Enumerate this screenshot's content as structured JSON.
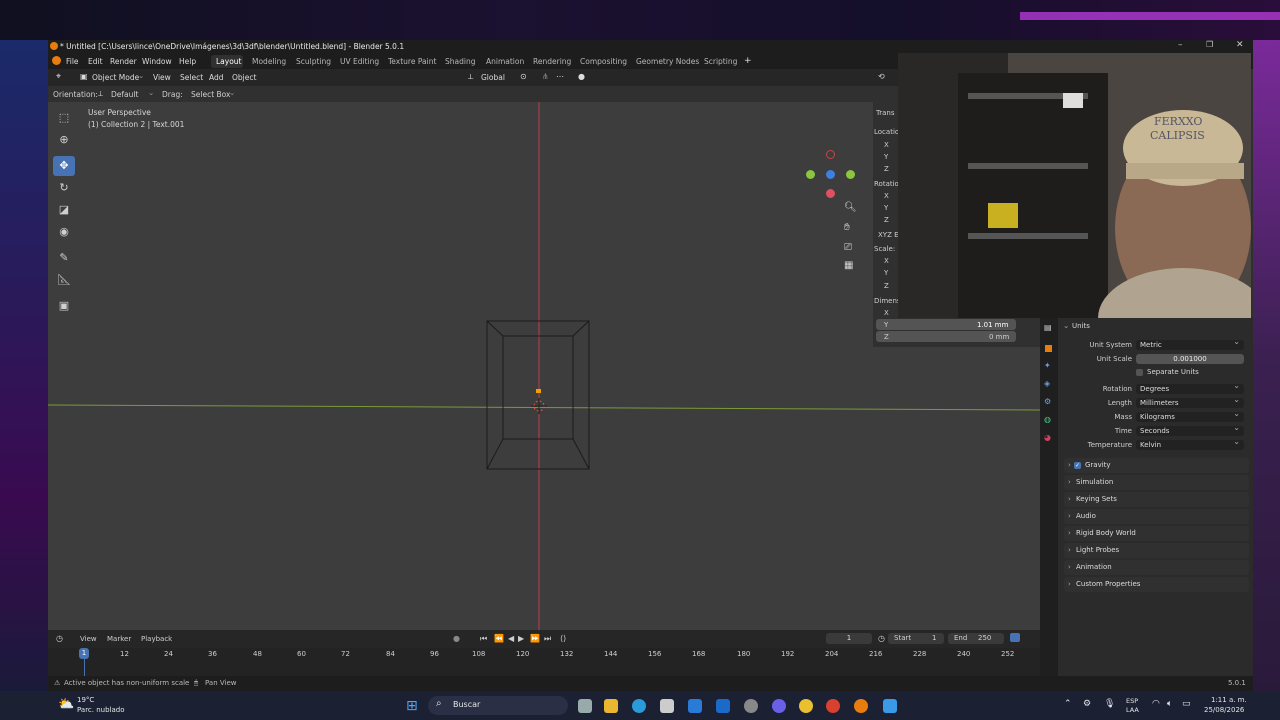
{
  "window": {
    "title": "* Untitled [C:\\Users\\lince\\OneDrive\\Imágenes\\3d\\3df\\blender\\Untitled.blend] - Blender 5.0.1"
  },
  "menu": {
    "file": "File",
    "edit": "Edit",
    "render": "Render",
    "window": "Window",
    "help": "Help"
  },
  "workspaces": [
    "Layout",
    "Modeling",
    "Sculpting",
    "UV Editing",
    "Texture Paint",
    "Shading",
    "Animation",
    "Rendering",
    "Compositing",
    "Geometry Nodes",
    "Scripting"
  ],
  "active_workspace": "Layout",
  "add_workspace_glyph": "+",
  "viewport_header": {
    "mode": "Object Mode",
    "view": "View",
    "select": "Select",
    "add": "Add",
    "object": "Object",
    "transform_orientation": "Global"
  },
  "tool_settings": {
    "orientation_label": "Orientation:",
    "orientation_value": "Default",
    "drag_label": "Drag:",
    "drag_value": "Select Box"
  },
  "viewport": {
    "perspective": "User Perspective",
    "collection_info": "(1) Collection 2 | Text.001"
  },
  "npanel": {
    "tab": "Trans",
    "location": "Location:",
    "rotation": "Rotation:",
    "rotation_mode": "XYZ E",
    "scale": "Scale:",
    "dimensions": "Dimens",
    "axes": [
      "X",
      "Y",
      "Z"
    ],
    "dim_y": "1.01 mm",
    "dim_z": "0 mm"
  },
  "properties": {
    "panel_title": "Units",
    "unit_system_label": "Unit System",
    "unit_system": "Metric",
    "unit_scale_label": "Unit Scale",
    "unit_scale": "0.001000",
    "separate_units": "Separate Units",
    "rotation_label": "Rotation",
    "rotation": "Degrees",
    "length_label": "Length",
    "length": "Millimeters",
    "mass_label": "Mass",
    "mass": "Kilograms",
    "time_label": "Time",
    "time": "Seconds",
    "temperature_label": "Temperature",
    "temperature": "Kelvin",
    "sections": [
      "Gravity",
      "Simulation",
      "Keying Sets",
      "Audio",
      "Rigid Body World",
      "Light Probes",
      "Animation",
      "Custom Properties"
    ]
  },
  "timeline": {
    "view": "View",
    "marker": "Marker",
    "playback": "Playback",
    "current_frame": "1",
    "start_label": "Start",
    "start": "1",
    "end_label": "End",
    "end": "250",
    "ruler": [
      "12",
      "24",
      "36",
      "48",
      "60",
      "72",
      "84",
      "96",
      "108",
      "120",
      "132",
      "144",
      "156",
      "168",
      "180",
      "192",
      "204",
      "216",
      "228",
      "240",
      "252"
    ],
    "playhead": "1"
  },
  "status": {
    "warning": "Active object has non-uniform scale",
    "hint": "Pan View",
    "version": "5.0.1"
  },
  "taskbar": {
    "weather_temp": "19°C",
    "weather_desc": "Parc. nublado",
    "search": "Buscar",
    "lang_top": "ESP",
    "lang_bottom": "LAA",
    "time": "1:11 a. m.",
    "date": "25/08/2026"
  },
  "webcam_overlay": {
    "cap_text_line1": "FERXXO",
    "cap_text_line2": "CALIPSIS"
  },
  "colors": {
    "accent": "#4772b3",
    "x_axis": "#e05060",
    "y_axis": "#8cc63f",
    "z_axis": "#3f7fe0"
  }
}
